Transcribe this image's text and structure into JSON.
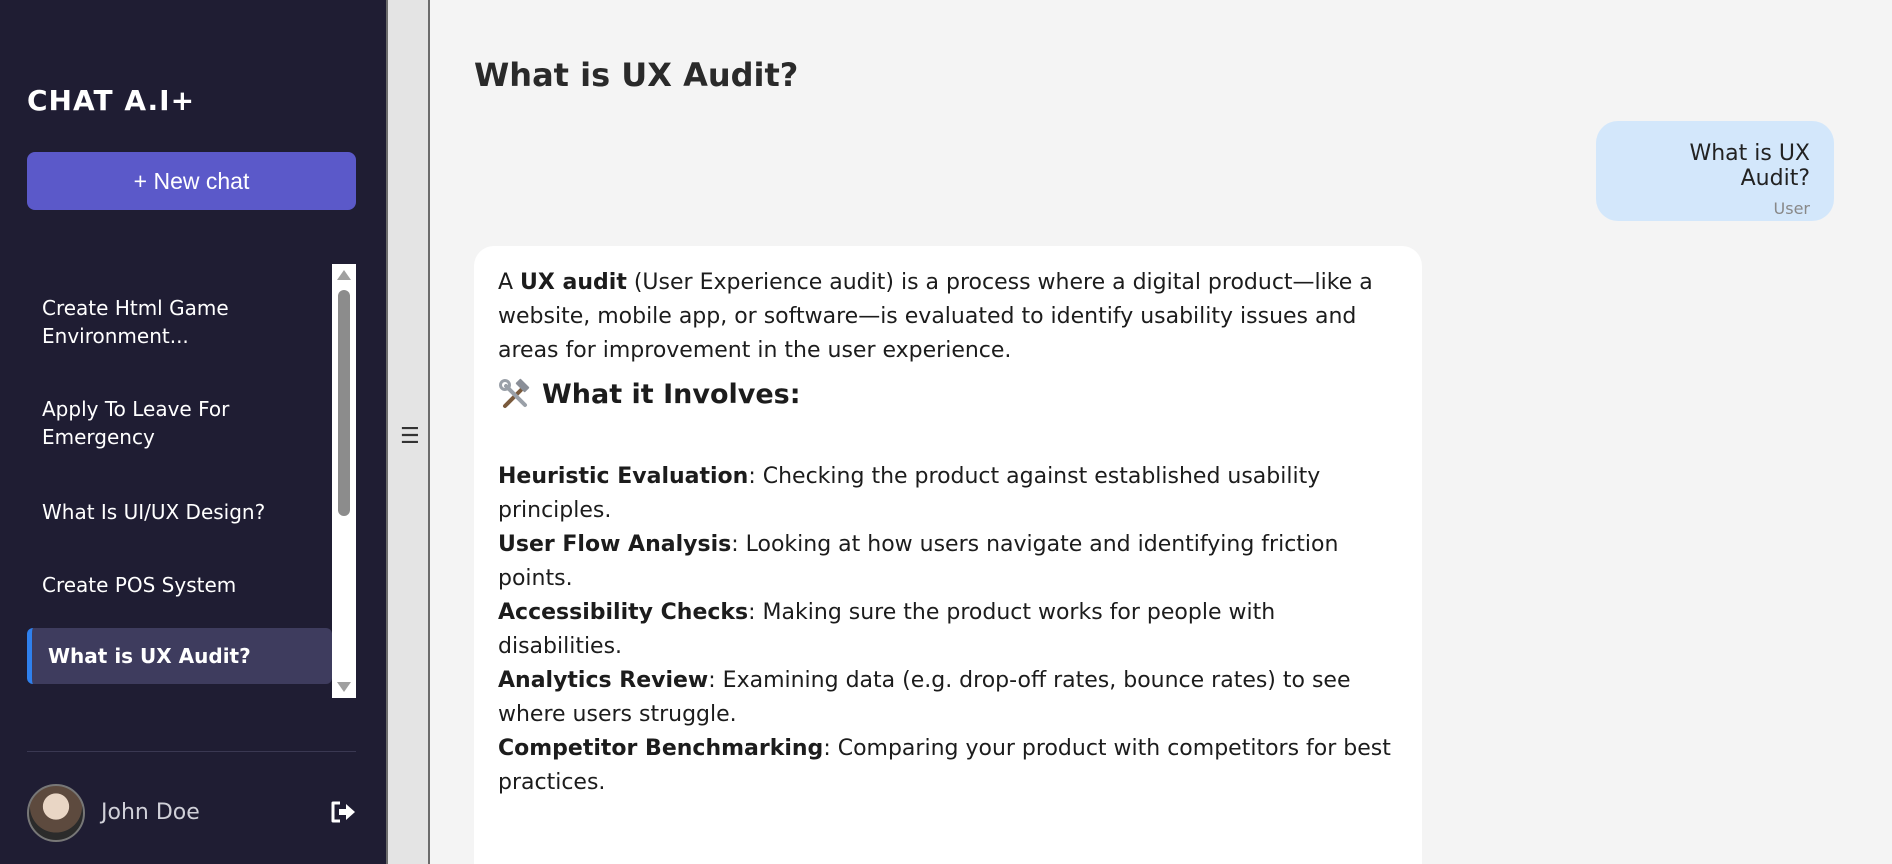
{
  "sidebar": {
    "brand": "CHAT A.I+",
    "new_chat_label": "+ New chat",
    "history": [
      {
        "label": "Create Html Game Environment..."
      },
      {
        "label": "Apply To Leave For Emergency"
      },
      {
        "label": "What Is UI/UX Design?"
      },
      {
        "label": "Create POS System"
      },
      {
        "label": "What is UX Audit?",
        "active": true
      }
    ],
    "user_name": "John Doe"
  },
  "main": {
    "title": "What is UX Audit?",
    "user_message": {
      "text": "What is UX Audit?",
      "sender": "User"
    },
    "assistant_message": {
      "intro_prefix": "A ",
      "intro_bold": "UX audit",
      "intro_rest": " (User Experience audit) is a process where a digital product—like a website, mobile app, or software—is evaluated to identify usability issues and areas for improvement in the user experience.",
      "section_heading": "What it Involves:",
      "section_icon": "hammer-wrench-icon",
      "points": [
        {
          "term": "Heuristic Evaluation",
          "desc": ": Checking the product against established usability principles."
        },
        {
          "term": "User Flow Analysis",
          "desc": ": Looking at how users navigate and identifying friction points."
        },
        {
          "term": "Accessibility Checks",
          "desc": ": Making sure the product works for people with disabilities."
        },
        {
          "term": "Analytics Review",
          "desc": ": Examining data (e.g. drop-off rates, bounce rates) to see where users struggle."
        },
        {
          "term": "Competitor Benchmarking",
          "desc": ": Comparing your product with competitors for best practices."
        }
      ]
    }
  },
  "colors": {
    "sidebar_bg": "#1f1d33",
    "accent": "#5b59c9",
    "active_indicator": "#2f80ed",
    "user_bubble": "#d3e7fb"
  },
  "icons": {
    "splitter": "hamburger-icon",
    "logout": "logout-icon"
  }
}
